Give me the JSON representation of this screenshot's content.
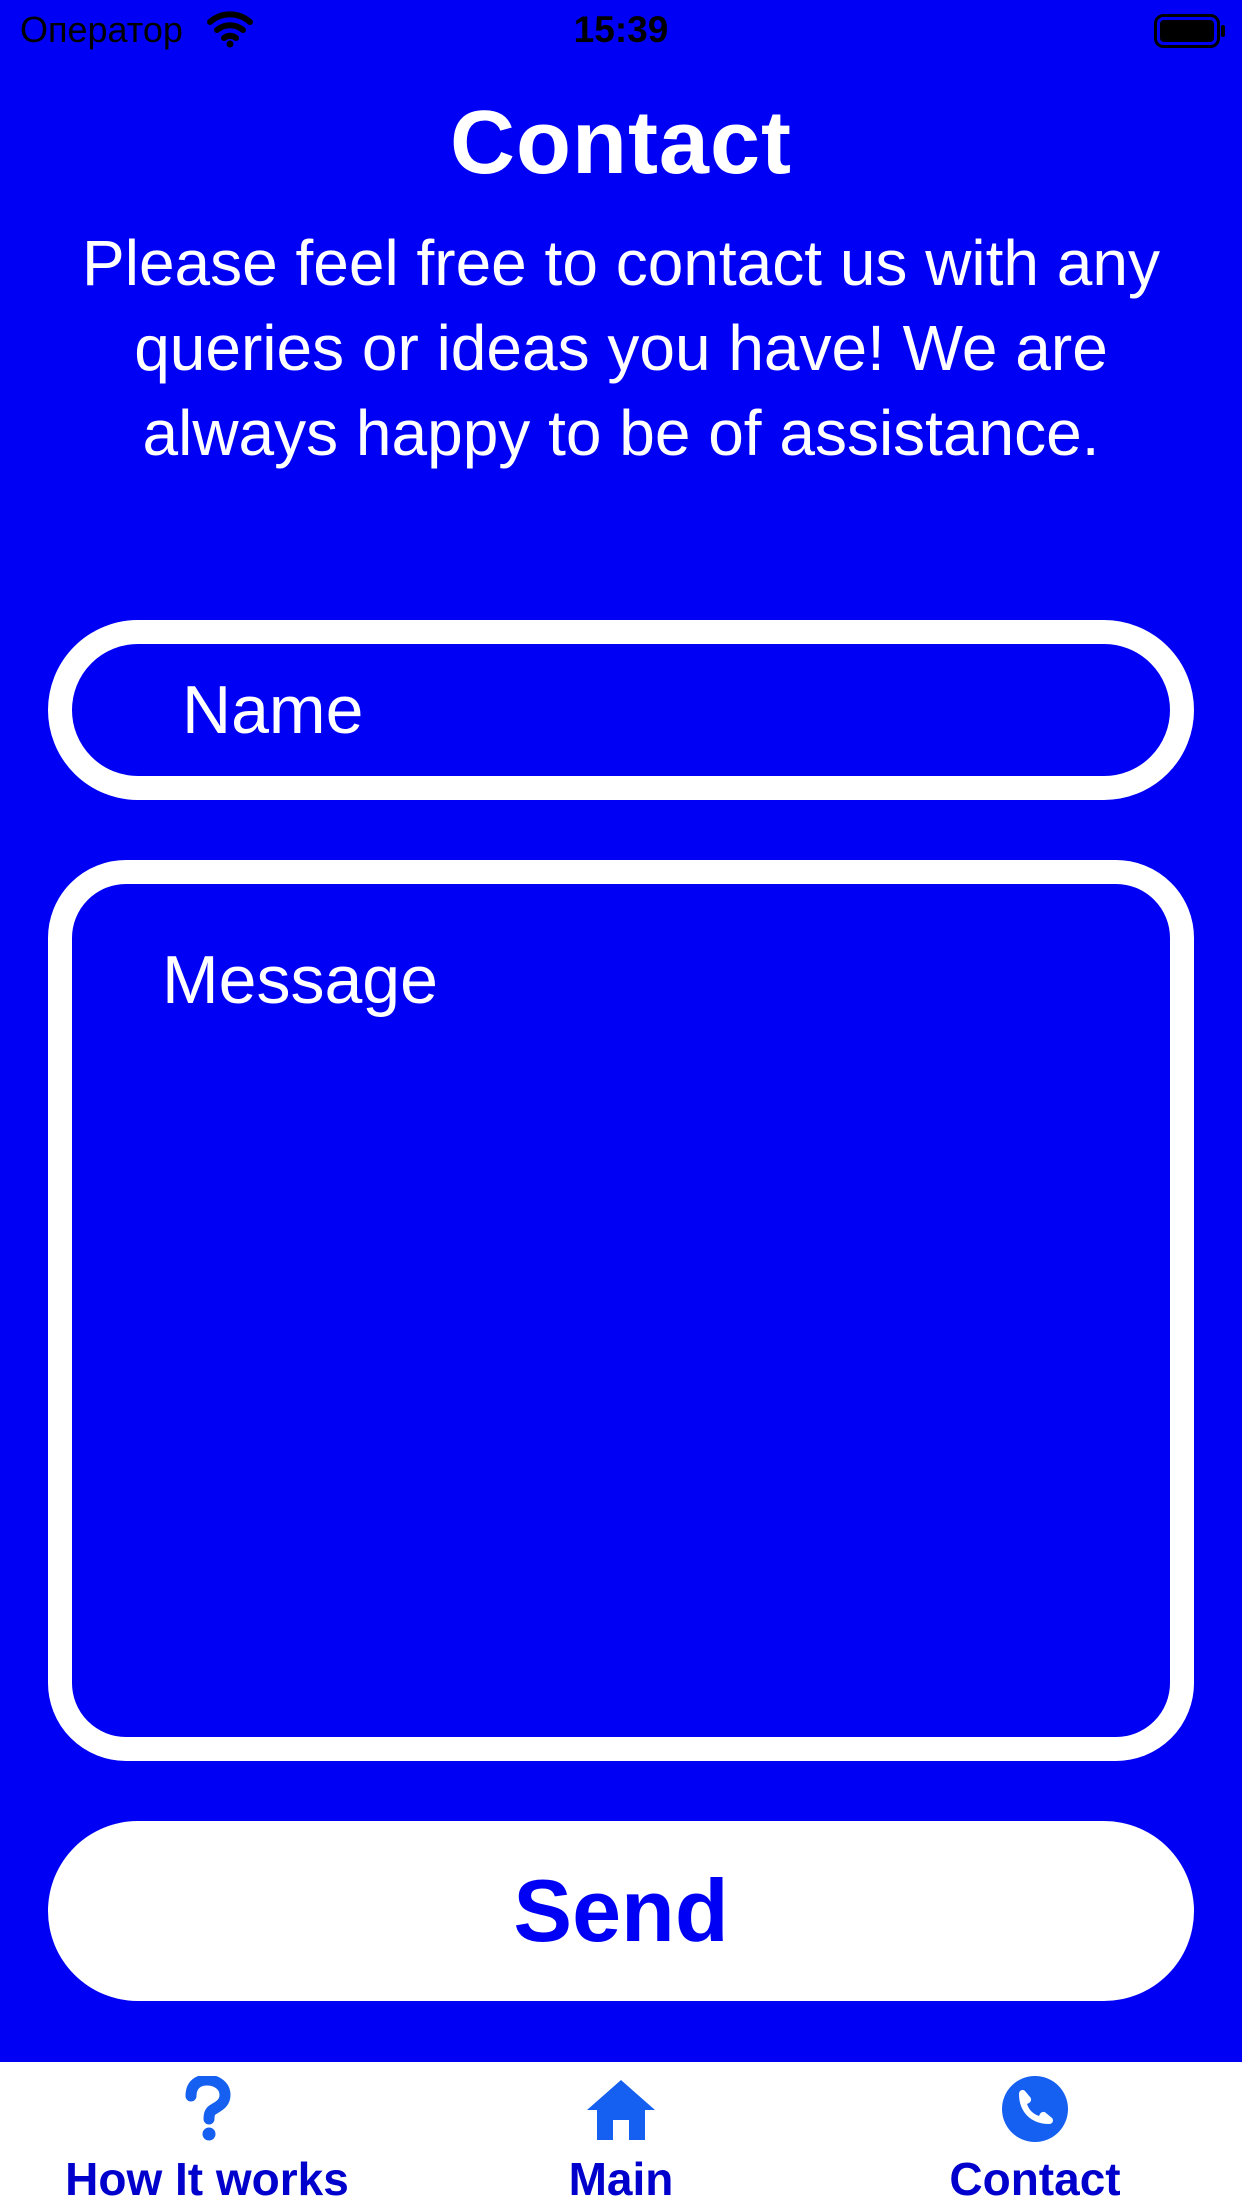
{
  "status_bar": {
    "carrier": "Оператор",
    "time": "15:39",
    "wifi_icon": "wifi-icon",
    "battery_icon": "battery-full-icon"
  },
  "header": {
    "title": "Contact",
    "intro": "Please feel free to contact us with any queries or ideas you have! We are always happy to be of assistance."
  },
  "form": {
    "name_placeholder": "Name",
    "name_value": "",
    "message_placeholder": "Message",
    "message_value": "",
    "send_label": "Send"
  },
  "tab_bar": {
    "items": [
      {
        "label": "How It works",
        "icon": "question-mark-icon"
      },
      {
        "label": "Main",
        "icon": "home-icon"
      },
      {
        "label": "Contact",
        "icon": "phone-icon",
        "selected": true
      }
    ]
  },
  "colors": {
    "background": "#0000F5",
    "foreground": "#FFFFFF",
    "accent": "#0000CD",
    "icon_blue": "#1560F0"
  }
}
